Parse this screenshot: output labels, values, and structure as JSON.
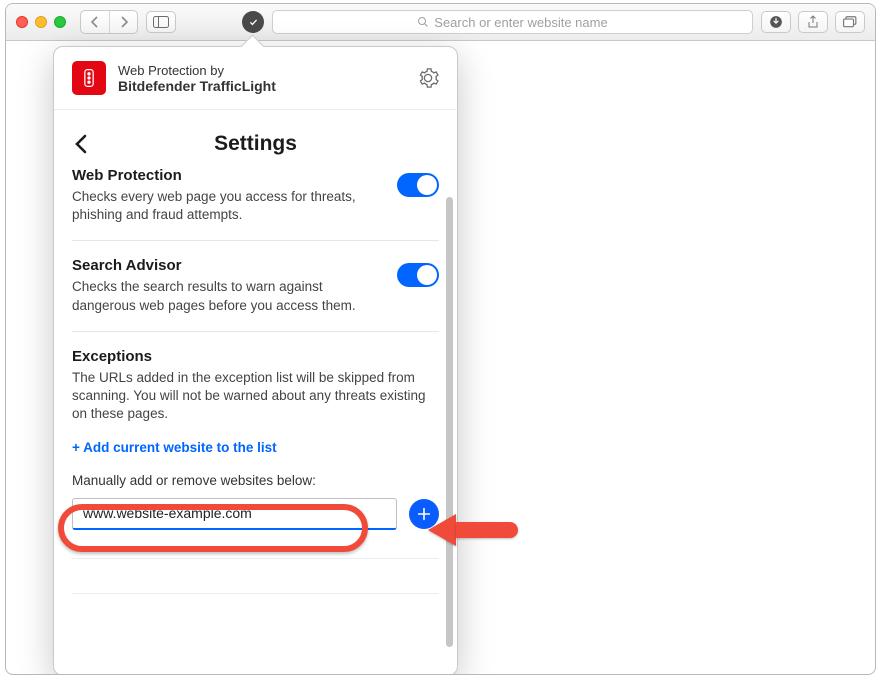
{
  "toolbar": {
    "search_placeholder": "Search or enter website name"
  },
  "popup": {
    "brand_line1": "Web Protection by",
    "brand_line2": "Bitdefender TrafficLight",
    "title": "Settings",
    "sections": {
      "web_protection": {
        "title": "Web Protection",
        "desc": "Checks every web page you access for threats, phishing and fraud attempts.",
        "enabled": true
      },
      "search_advisor": {
        "title": "Search Advisor",
        "desc": "Checks the search results to warn against dangerous web pages before you access them.",
        "enabled": true
      },
      "exceptions": {
        "title": "Exceptions",
        "desc": "The URLs added in the exception list will be skipped from scanning. You will not be warned about any threats existing on these pages.",
        "add_current_link": "+ Add current website to the list",
        "manual_label": "Manually add or remove websites below:",
        "input_value": "www.website-example.com"
      }
    }
  }
}
